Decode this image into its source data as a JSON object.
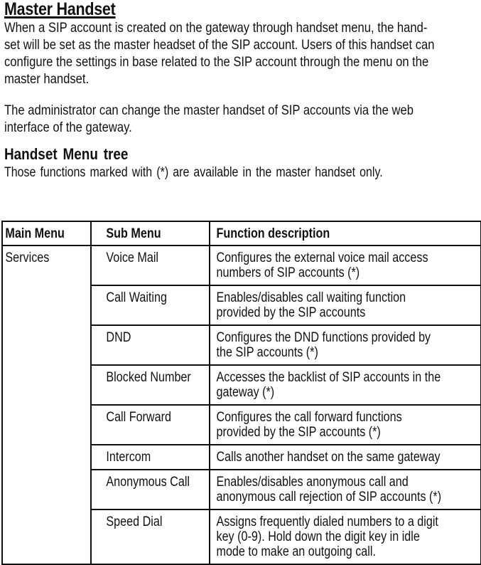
{
  "section": {
    "title": "Master Handset",
    "paragraph1_lines": [
      "When a SIP account is created on the gateway through handset menu, the hand-",
      "set will be set as the master headset of the SIP account. Users of this handset can",
      "configure the settings in base related to the SIP account through the menu on the",
      "master handset."
    ],
    "paragraph2_lines": [
      "The administrator can change the master handset of SIP accounts via the web",
      "interface of the gateway."
    ]
  },
  "menu_tree": {
    "title": "Handset Menu tree",
    "note": "Those functions marked with (*) are available in the master handset only.",
    "table": {
      "headers": [
        "Main Menu",
        "Sub Menu",
        "Function description"
      ],
      "main_menu": "Services",
      "rows": [
        {
          "sub": "Voice Mail",
          "desc": [
            "Configures the external voice mail access",
            "numbers of SIP accounts (*)"
          ]
        },
        {
          "sub": "Call Waiting",
          "desc": [
            "Enables/disables  call  waiting  function",
            "provided by the SIP accounts"
          ]
        },
        {
          "sub": "DND",
          "desc": [
            "Configures the DND functions provided by",
            "the SIP accounts (*)"
          ]
        },
        {
          "sub": "Blocked Number",
          "desc": [
            "Accesses the backlist of SIP accounts in the",
            "gateway (*)"
          ]
        },
        {
          "sub": "Call Forward",
          "desc": [
            "Configures  the  call  forward  functions",
            "provided by the SIP accounts (*)"
          ]
        },
        {
          "sub": "Intercom",
          "desc": [
            "Calls another handset on the same gateway"
          ]
        },
        {
          "sub": "Anonymous Call",
          "desc": [
            "Enables/disables anonymous call and",
            "anonymous call rejection of SIP accounts (*)"
          ]
        },
        {
          "sub": "Speed Dial",
          "desc": [
            "Assigns frequently dialed numbers to a digit",
            "key (0-9). Hold down the digit key in idle",
            "mode to make an outgoing call."
          ]
        }
      ]
    }
  }
}
